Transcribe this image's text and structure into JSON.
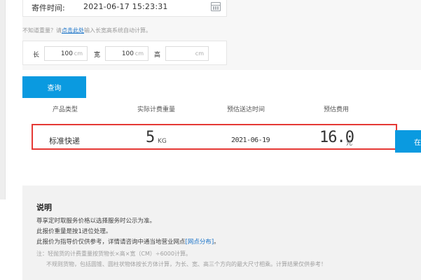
{
  "form": {
    "send_time_label": "寄件时间:",
    "send_time_value": "2021-06-17 15:23:31",
    "hint_prefix": "不知道重量？请",
    "hint_link": "点击此处",
    "hint_suffix": "输入长宽高系统自动计算。",
    "length_label": "长",
    "length_value": "100",
    "width_label": "宽",
    "width_value": "100",
    "height_label": "高",
    "height_value": "",
    "unit": "cm",
    "query_button": "查询"
  },
  "table": {
    "headers": [
      "产品类型",
      "实际计费重量",
      "预估送达时间",
      "预估费用"
    ],
    "row": {
      "product": "标准快递",
      "weight": "5",
      "weight_unit": "KG",
      "delivery_date": "2021-06-19",
      "fee": "16.0",
      "fee_unit": "元",
      "order_button": "在"
    },
    "highlight_color": "#e53935"
  },
  "notes": {
    "title": "说明",
    "line1": "尊享定时取服务价格以选择服务时公示为准。",
    "line2": "此报价重量是按1进位处理。",
    "line3_prefix": "此报价为指导价仅供参考，详情请咨询中通当地营业网点",
    "line3_link": "[网点分布]",
    "line3_suffix": "。",
    "line4": "注：轻抛货的计费重量按货物长×高×宽（CM）÷6000计算。",
    "line5": "不规则货物，包括圆锥、圆柱状物体按长方体计算，为长、宽、高三个方向的最大尺寸相乘。计算结果仅供参考！"
  },
  "colors": {
    "accent": "#0a9ae0",
    "link": "#1a73c8"
  }
}
